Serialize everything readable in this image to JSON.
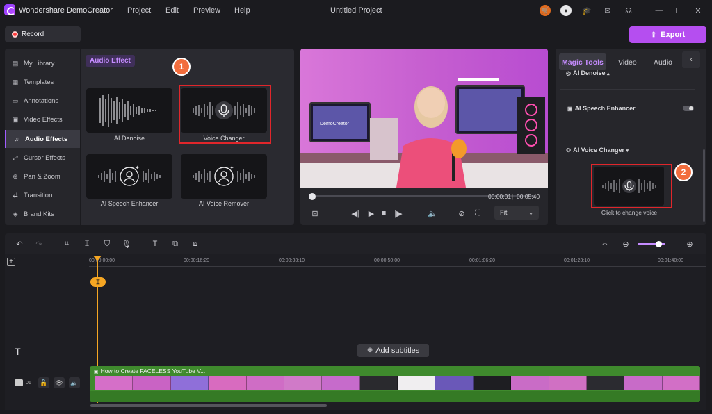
{
  "app": {
    "title": "Wondershare DemoCreator",
    "project_title": "Untitled Project",
    "menu": [
      "Project",
      "Edit",
      "Preview",
      "Help"
    ]
  },
  "toolbar": {
    "record_label": "Record",
    "export_label": "Export"
  },
  "sidebar": {
    "items": [
      {
        "label": "My Library",
        "icon": "library-icon"
      },
      {
        "label": "Templates",
        "icon": "templates-icon"
      },
      {
        "label": "Annotations",
        "icon": "annotations-icon"
      },
      {
        "label": "Video Effects",
        "icon": "video-effects-icon"
      },
      {
        "label": "Audio Effects",
        "icon": "audio-effects-icon",
        "active": true
      },
      {
        "label": "Cursor Effects",
        "icon": "cursor-icon"
      },
      {
        "label": "Pan & Zoom",
        "icon": "pan-zoom-icon"
      },
      {
        "label": "Transition",
        "icon": "transition-icon"
      },
      {
        "label": "Brand Kits",
        "icon": "brand-kits-icon"
      }
    ]
  },
  "effects": {
    "section_label": "Audio Effect",
    "step1": "1",
    "cards": [
      {
        "label": "AI Denoise"
      },
      {
        "label": "Voice Changer",
        "highlighted": true
      },
      {
        "label": "AI Speech Enhancer"
      },
      {
        "label": "AI Voice Remover"
      }
    ]
  },
  "player": {
    "current_time": "00:00:01",
    "total_time": "00:05:40",
    "fit_label": "Fit",
    "screen_logo_text": "DemoCreator"
  },
  "magic": {
    "tabs": [
      "Magic Tools",
      "Video",
      "Audio"
    ],
    "denoise": "AI Denoise",
    "speech": "AI Speech Enhancer",
    "voice_changer": "AI Voice Changer",
    "step2": "2",
    "change_caption": "Click to change voice"
  },
  "timeline": {
    "ruler": [
      "00:00:00:00",
      "00:00:16:20",
      "00:00:33:10",
      "00:00:50:00",
      "00:01:06:20",
      "00:01:23:10",
      "00:01:40:00"
    ],
    "add_subtitles": "Add subtitles",
    "track_number": "01",
    "clip_title": "How to Create FACELESS YouTube V..."
  },
  "colors": {
    "accent": "#b54ef0",
    "highlight": "#e0262b",
    "badge": "#f26d3d",
    "clip": "#3f8a2d",
    "playhead": "#f5a623"
  }
}
